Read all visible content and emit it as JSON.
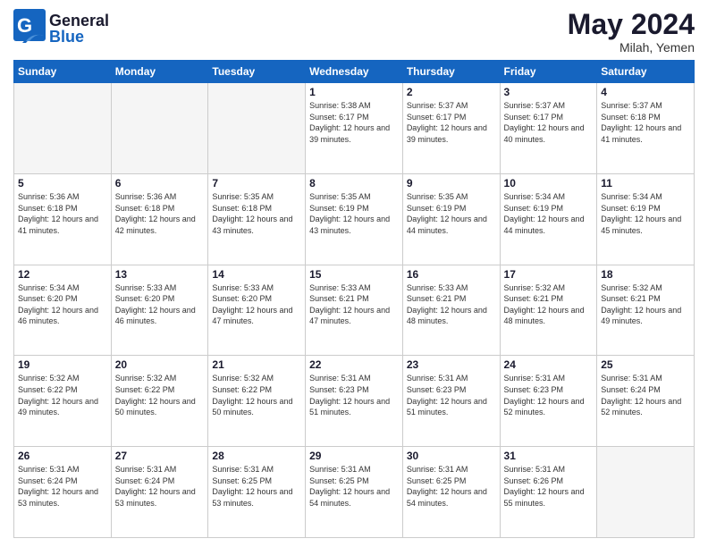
{
  "header": {
    "logo_general": "General",
    "logo_blue": "Blue",
    "month_title": "May 2024",
    "location": "Milah, Yemen"
  },
  "weekdays": [
    "Sunday",
    "Monday",
    "Tuesday",
    "Wednesday",
    "Thursday",
    "Friday",
    "Saturday"
  ],
  "weeks": [
    [
      {
        "day": "",
        "sunrise": "",
        "sunset": "",
        "daylight": "",
        "empty": true
      },
      {
        "day": "",
        "sunrise": "",
        "sunset": "",
        "daylight": "",
        "empty": true
      },
      {
        "day": "",
        "sunrise": "",
        "sunset": "",
        "daylight": "",
        "empty": true
      },
      {
        "day": "1",
        "sunrise": "Sunrise: 5:38 AM",
        "sunset": "Sunset: 6:17 PM",
        "daylight": "Daylight: 12 hours and 39 minutes.",
        "empty": false
      },
      {
        "day": "2",
        "sunrise": "Sunrise: 5:37 AM",
        "sunset": "Sunset: 6:17 PM",
        "daylight": "Daylight: 12 hours and 39 minutes.",
        "empty": false
      },
      {
        "day": "3",
        "sunrise": "Sunrise: 5:37 AM",
        "sunset": "Sunset: 6:17 PM",
        "daylight": "Daylight: 12 hours and 40 minutes.",
        "empty": false
      },
      {
        "day": "4",
        "sunrise": "Sunrise: 5:37 AM",
        "sunset": "Sunset: 6:18 PM",
        "daylight": "Daylight: 12 hours and 41 minutes.",
        "empty": false
      }
    ],
    [
      {
        "day": "5",
        "sunrise": "Sunrise: 5:36 AM",
        "sunset": "Sunset: 6:18 PM",
        "daylight": "Daylight: 12 hours and 41 minutes.",
        "empty": false
      },
      {
        "day": "6",
        "sunrise": "Sunrise: 5:36 AM",
        "sunset": "Sunset: 6:18 PM",
        "daylight": "Daylight: 12 hours and 42 minutes.",
        "empty": false
      },
      {
        "day": "7",
        "sunrise": "Sunrise: 5:35 AM",
        "sunset": "Sunset: 6:18 PM",
        "daylight": "Daylight: 12 hours and 43 minutes.",
        "empty": false
      },
      {
        "day": "8",
        "sunrise": "Sunrise: 5:35 AM",
        "sunset": "Sunset: 6:19 PM",
        "daylight": "Daylight: 12 hours and 43 minutes.",
        "empty": false
      },
      {
        "day": "9",
        "sunrise": "Sunrise: 5:35 AM",
        "sunset": "Sunset: 6:19 PM",
        "daylight": "Daylight: 12 hours and 44 minutes.",
        "empty": false
      },
      {
        "day": "10",
        "sunrise": "Sunrise: 5:34 AM",
        "sunset": "Sunset: 6:19 PM",
        "daylight": "Daylight: 12 hours and 44 minutes.",
        "empty": false
      },
      {
        "day": "11",
        "sunrise": "Sunrise: 5:34 AM",
        "sunset": "Sunset: 6:19 PM",
        "daylight": "Daylight: 12 hours and 45 minutes.",
        "empty": false
      }
    ],
    [
      {
        "day": "12",
        "sunrise": "Sunrise: 5:34 AM",
        "sunset": "Sunset: 6:20 PM",
        "daylight": "Daylight: 12 hours and 46 minutes.",
        "empty": false
      },
      {
        "day": "13",
        "sunrise": "Sunrise: 5:33 AM",
        "sunset": "Sunset: 6:20 PM",
        "daylight": "Daylight: 12 hours and 46 minutes.",
        "empty": false
      },
      {
        "day": "14",
        "sunrise": "Sunrise: 5:33 AM",
        "sunset": "Sunset: 6:20 PM",
        "daylight": "Daylight: 12 hours and 47 minutes.",
        "empty": false
      },
      {
        "day": "15",
        "sunrise": "Sunrise: 5:33 AM",
        "sunset": "Sunset: 6:21 PM",
        "daylight": "Daylight: 12 hours and 47 minutes.",
        "empty": false
      },
      {
        "day": "16",
        "sunrise": "Sunrise: 5:33 AM",
        "sunset": "Sunset: 6:21 PM",
        "daylight": "Daylight: 12 hours and 48 minutes.",
        "empty": false
      },
      {
        "day": "17",
        "sunrise": "Sunrise: 5:32 AM",
        "sunset": "Sunset: 6:21 PM",
        "daylight": "Daylight: 12 hours and 48 minutes.",
        "empty": false
      },
      {
        "day": "18",
        "sunrise": "Sunrise: 5:32 AM",
        "sunset": "Sunset: 6:21 PM",
        "daylight": "Daylight: 12 hours and 49 minutes.",
        "empty": false
      }
    ],
    [
      {
        "day": "19",
        "sunrise": "Sunrise: 5:32 AM",
        "sunset": "Sunset: 6:22 PM",
        "daylight": "Daylight: 12 hours and 49 minutes.",
        "empty": false
      },
      {
        "day": "20",
        "sunrise": "Sunrise: 5:32 AM",
        "sunset": "Sunset: 6:22 PM",
        "daylight": "Daylight: 12 hours and 50 minutes.",
        "empty": false
      },
      {
        "day": "21",
        "sunrise": "Sunrise: 5:32 AM",
        "sunset": "Sunset: 6:22 PM",
        "daylight": "Daylight: 12 hours and 50 minutes.",
        "empty": false
      },
      {
        "day": "22",
        "sunrise": "Sunrise: 5:31 AM",
        "sunset": "Sunset: 6:23 PM",
        "daylight": "Daylight: 12 hours and 51 minutes.",
        "empty": false
      },
      {
        "day": "23",
        "sunrise": "Sunrise: 5:31 AM",
        "sunset": "Sunset: 6:23 PM",
        "daylight": "Daylight: 12 hours and 51 minutes.",
        "empty": false
      },
      {
        "day": "24",
        "sunrise": "Sunrise: 5:31 AM",
        "sunset": "Sunset: 6:23 PM",
        "daylight": "Daylight: 12 hours and 52 minutes.",
        "empty": false
      },
      {
        "day": "25",
        "sunrise": "Sunrise: 5:31 AM",
        "sunset": "Sunset: 6:24 PM",
        "daylight": "Daylight: 12 hours and 52 minutes.",
        "empty": false
      }
    ],
    [
      {
        "day": "26",
        "sunrise": "Sunrise: 5:31 AM",
        "sunset": "Sunset: 6:24 PM",
        "daylight": "Daylight: 12 hours and 53 minutes.",
        "empty": false
      },
      {
        "day": "27",
        "sunrise": "Sunrise: 5:31 AM",
        "sunset": "Sunset: 6:24 PM",
        "daylight": "Daylight: 12 hours and 53 minutes.",
        "empty": false
      },
      {
        "day": "28",
        "sunrise": "Sunrise: 5:31 AM",
        "sunset": "Sunset: 6:25 PM",
        "daylight": "Daylight: 12 hours and 53 minutes.",
        "empty": false
      },
      {
        "day": "29",
        "sunrise": "Sunrise: 5:31 AM",
        "sunset": "Sunset: 6:25 PM",
        "daylight": "Daylight: 12 hours and 54 minutes.",
        "empty": false
      },
      {
        "day": "30",
        "sunrise": "Sunrise: 5:31 AM",
        "sunset": "Sunset: 6:25 PM",
        "daylight": "Daylight: 12 hours and 54 minutes.",
        "empty": false
      },
      {
        "day": "31",
        "sunrise": "Sunrise: 5:31 AM",
        "sunset": "Sunset: 6:26 PM",
        "daylight": "Daylight: 12 hours and 55 minutes.",
        "empty": false
      },
      {
        "day": "",
        "sunrise": "",
        "sunset": "",
        "daylight": "",
        "empty": true
      }
    ]
  ]
}
